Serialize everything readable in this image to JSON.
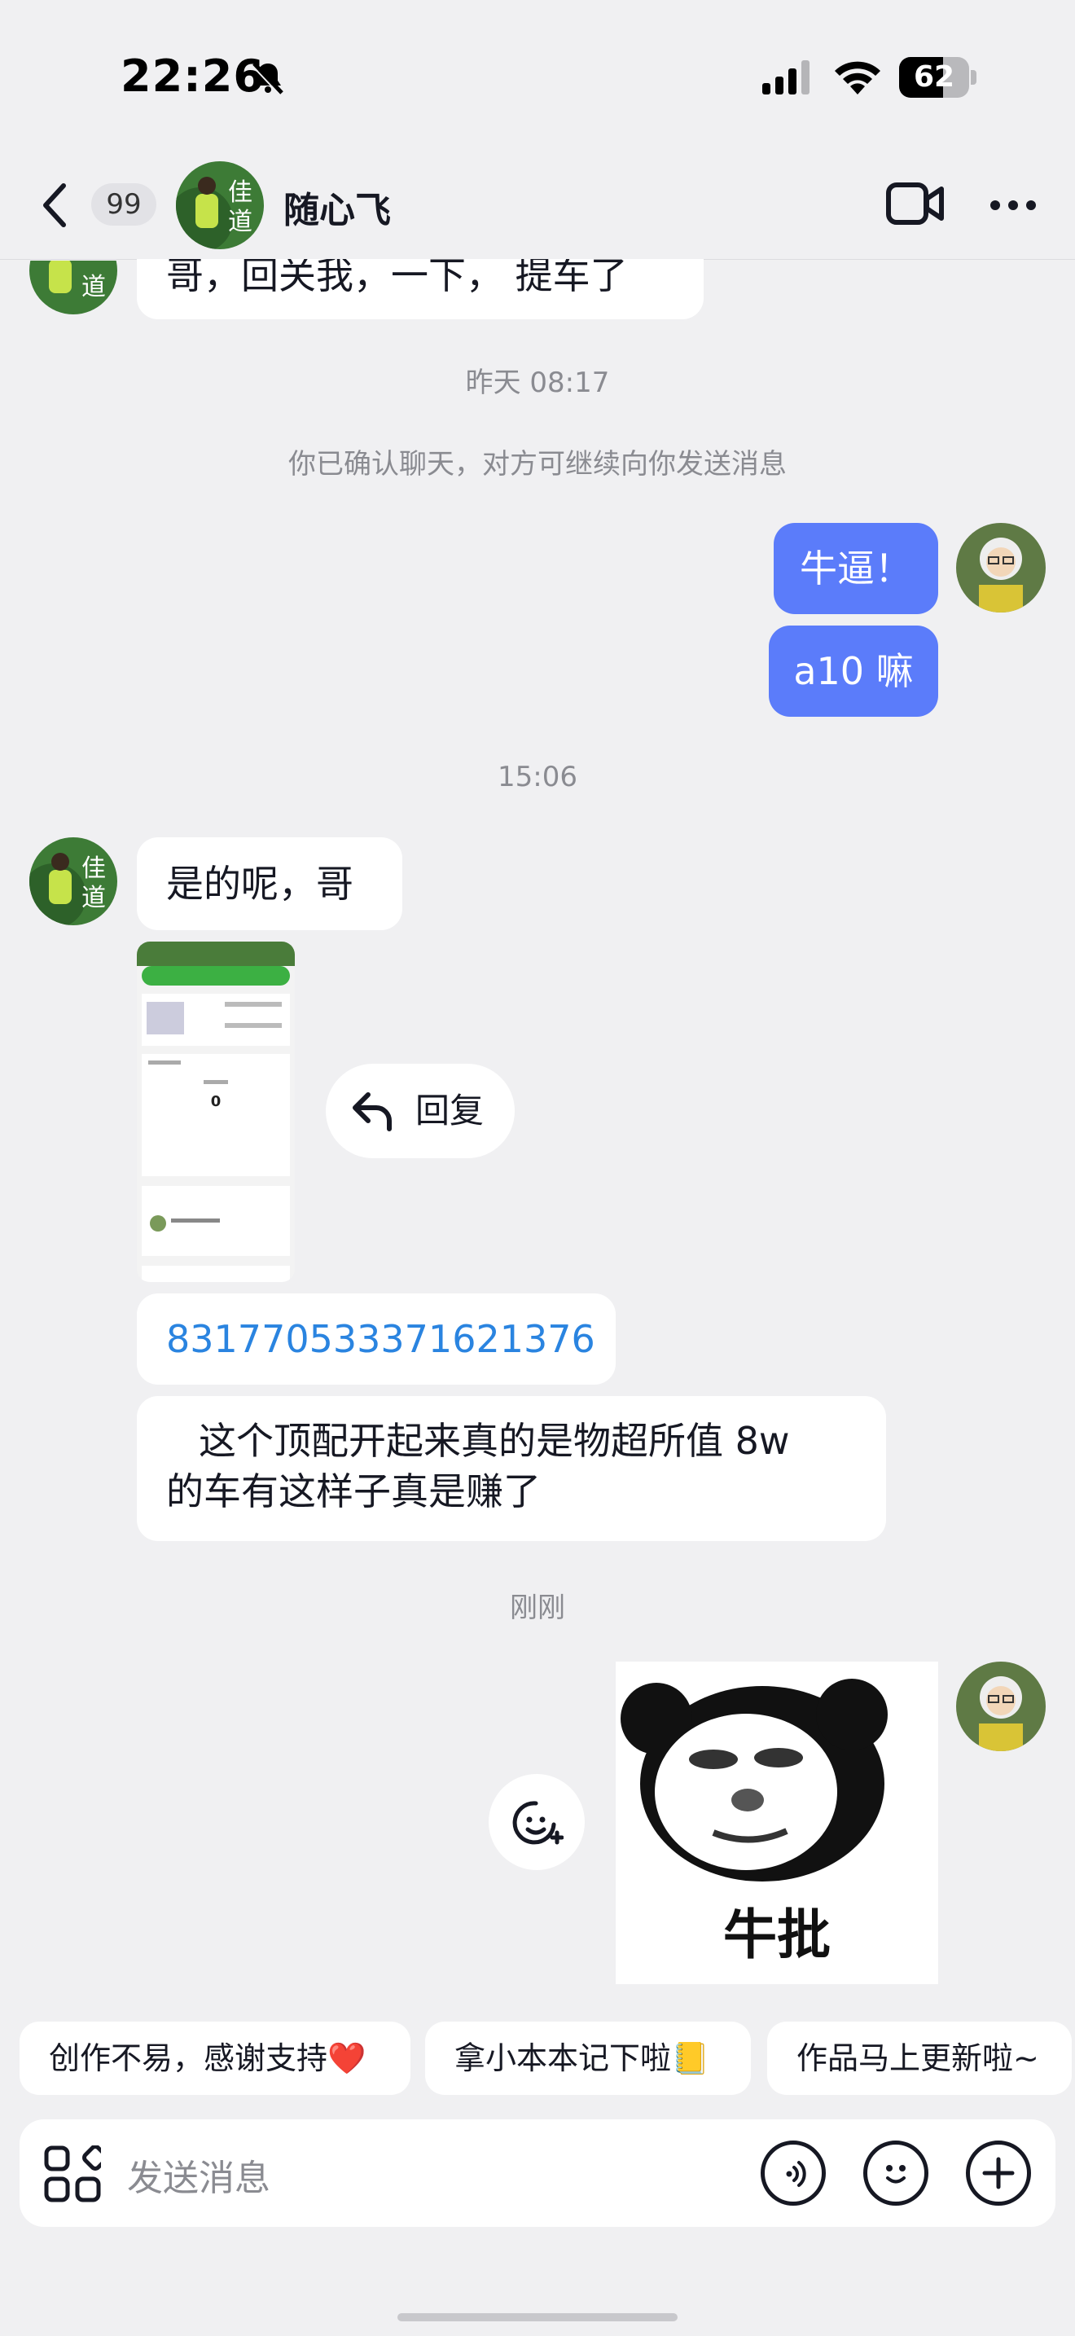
{
  "status_bar": {
    "time": "22:26",
    "battery": "62"
  },
  "header": {
    "back_count": "99",
    "title": "随心飞"
  },
  "messages": {
    "m1": "哥，回关我，一下， 提车了",
    "time1": "昨天 08:17",
    "notice": "你已确认聊天，对方可继续向你发送消息",
    "m2": "牛逼！",
    "m3": "a10 嘛",
    "time2": "15:06",
    "m4": "是的呢，哥",
    "reply_label": "回复",
    "m5": "831770533371621376",
    "m6_line1": "这个顶配开起来真的是物超所值  8w",
    "m6_line2": "的车有这样子真是赚了",
    "time3": "刚刚",
    "sticker_text": "牛批"
  },
  "screenshot_card": {
    "zero": "0"
  },
  "quick_replies": [
    "创作不易，感谢支持❤️",
    "拿小本本记下啦📒",
    "作品马上更新啦~"
  ],
  "input": {
    "placeholder": "发送消息"
  },
  "colors": {
    "accent": "#5b7cfa",
    "link": "#2a84e0"
  }
}
